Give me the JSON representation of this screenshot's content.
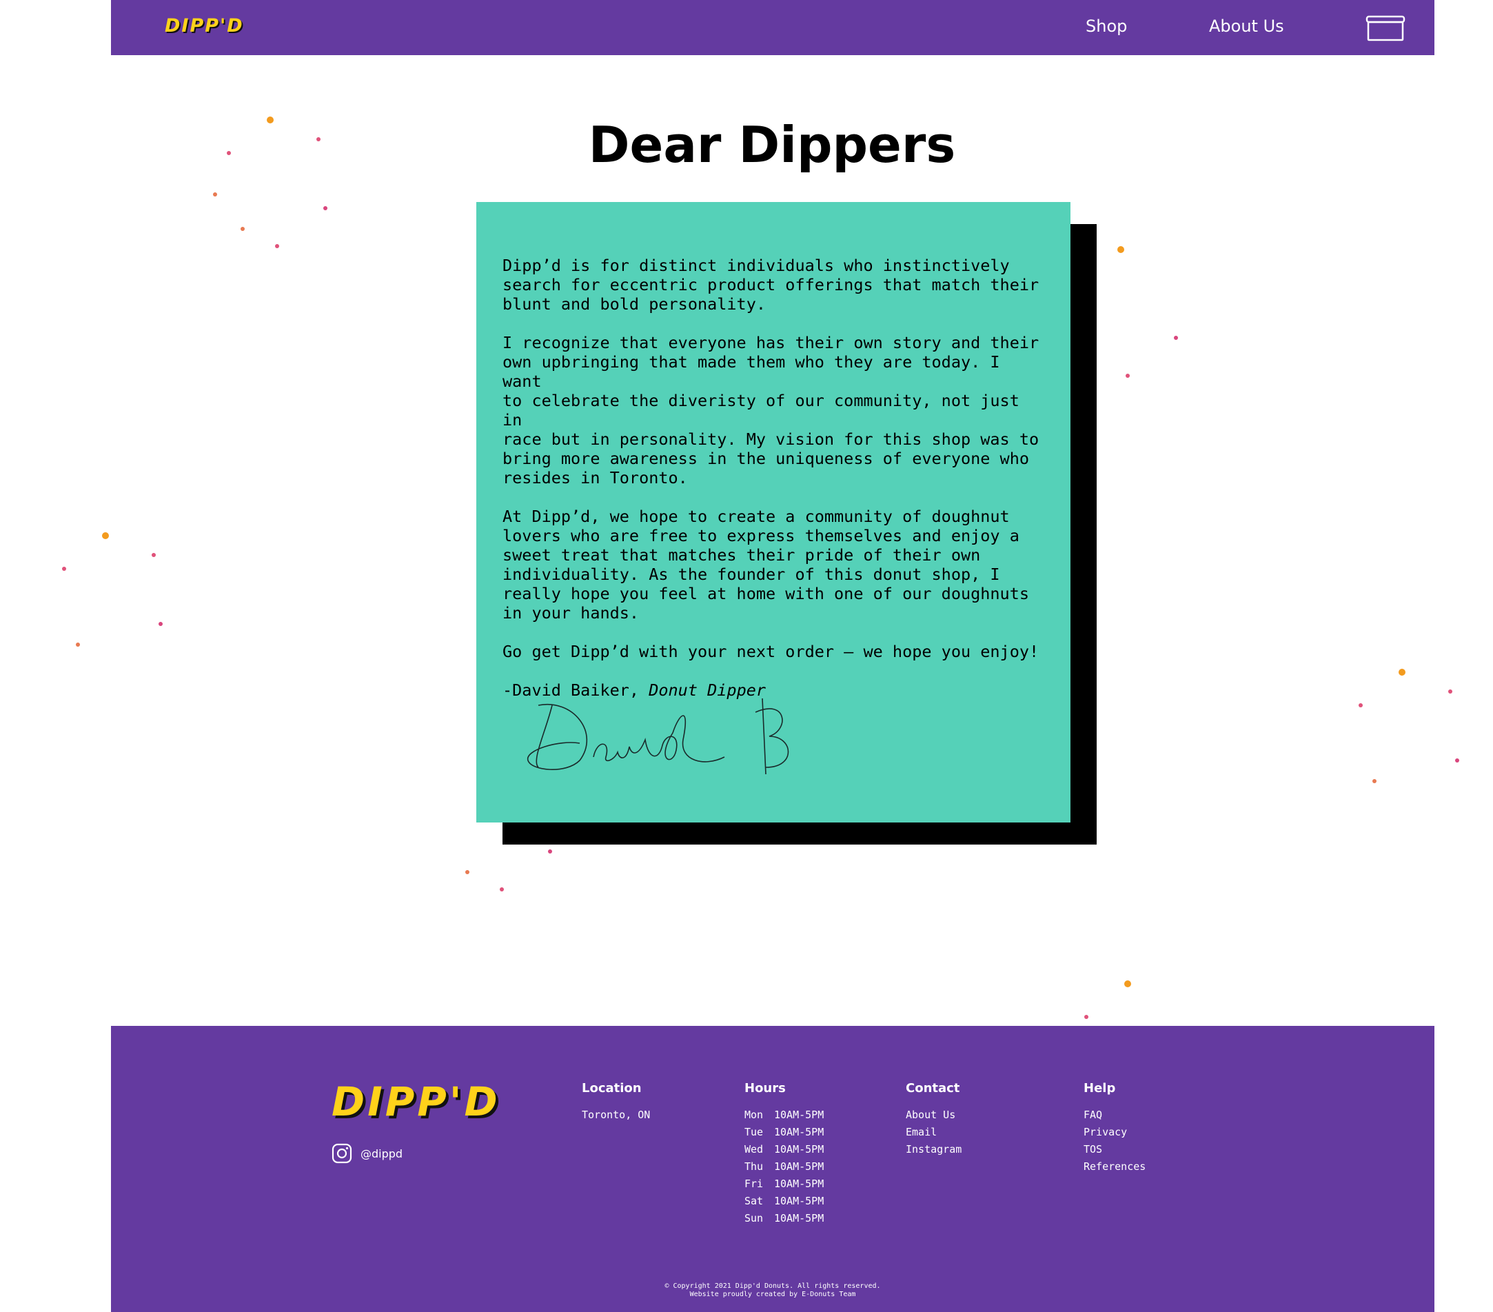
{
  "colors": {
    "purple": "#643aa0",
    "teal": "#55d1b8",
    "logo_yellow": "#ffd21a"
  },
  "nav": {
    "logo": "DIPP'D",
    "links": [
      {
        "label": "Shop"
      },
      {
        "label": "About Us"
      }
    ],
    "cart_icon": "cart-icon"
  },
  "main": {
    "heading": "Dear Dippers",
    "letter": {
      "paragraphs": [
        "Dipp’d is for distinct individuals who instinctively\nsearch for eccentric product offerings that match their\nblunt and bold personality.",
        "I recognize that everyone has their own story and their\nown upbringing that made them who they are today. I want\nto celebrate the diveristy of our community, not just in\nrace but in personality. My vision for this shop was to\nbring more awareness in the uniqueness of everyone who\nresides in Toronto.",
        "At Dipp’d, we hope to create a community of doughnut\nlovers who are free to express themselves and enjoy a\nsweet treat that matches their pride of their own\nindividuality. As the founder of this donut shop, I\nreally hope you feel at home with one of our doughnuts\nin your hands.",
        "Go get Dipp’d with your next order — we hope you enjoy!"
      ],
      "signoff_name": "-David Baiker, ",
      "signoff_title": "Donut Dipper"
    }
  },
  "footer": {
    "logo": "DIPP'D",
    "instagram_handle": "@dippd",
    "location": {
      "title": "Location",
      "text": "Toronto, ON"
    },
    "hours": {
      "title": "Hours",
      "rows": [
        {
          "day": "Mon",
          "time": "10AM-5PM"
        },
        {
          "day": "Tue",
          "time": "10AM-5PM"
        },
        {
          "day": "Wed",
          "time": "10AM-5PM"
        },
        {
          "day": "Thu",
          "time": "10AM-5PM"
        },
        {
          "day": "Fri",
          "time": "10AM-5PM"
        },
        {
          "day": "Sat",
          "time": "10AM-5PM"
        },
        {
          "day": "Sun",
          "time": "10AM-5PM"
        }
      ]
    },
    "contact": {
      "title": "Contact",
      "links": [
        "About Us",
        "Email",
        "Instagram"
      ]
    },
    "help": {
      "title": "Help",
      "links": [
        "FAQ",
        "Privacy",
        "TOS",
        "References"
      ]
    },
    "copyright_line1": "© Copyright 2021 Dipp'd Donuts. All rights reserved.",
    "copyright_line2": "Website proudly created by E-Donuts Team"
  }
}
